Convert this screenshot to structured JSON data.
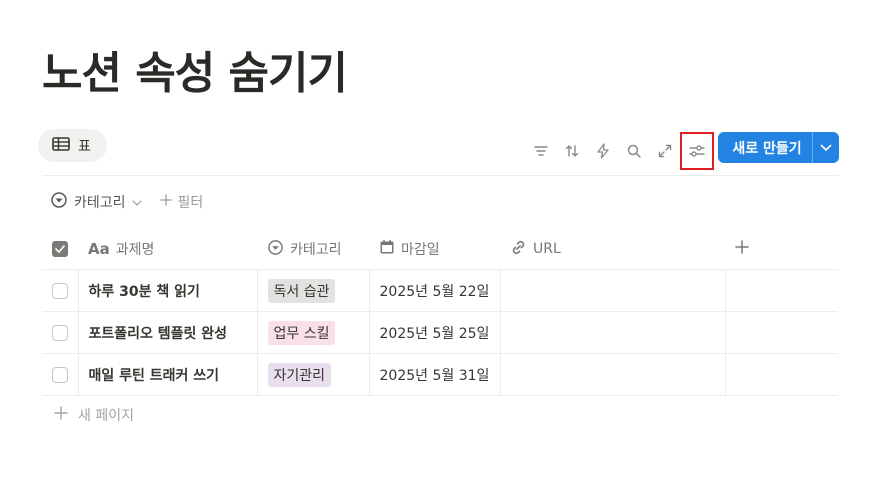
{
  "page": {
    "title": "노션 속성 숨기기"
  },
  "view_tab": {
    "label": "표",
    "icon": "table-icon"
  },
  "toolbar": {
    "icons": [
      "filter-icon",
      "sort-icon",
      "automation-icon",
      "search-icon",
      "expand-icon",
      "settings-sliders-icon"
    ],
    "new_button_label": "새로 만들기",
    "accent_color": "#2383e2",
    "highlight_color": "#e02020"
  },
  "filters": {
    "category_filter": "카테고리",
    "add_filter": "필터"
  },
  "table": {
    "headers": {
      "title": "과제명",
      "category": "카테고리",
      "deadline": "마감일",
      "url": "URL"
    },
    "rows": [
      {
        "title": "하루 30분 책 읽기",
        "category": "독서 습관",
        "category_color": "#e3e2e0",
        "deadline": "2025년 5월 22일",
        "url": ""
      },
      {
        "title": "포트폴리오 템플릿 완성",
        "category": "업무 스킬",
        "category_color": "#f9dfe9",
        "deadline": "2025년 5월 25일",
        "url": ""
      },
      {
        "title": "매일 루틴 트래커 쓰기",
        "category": "자기관리",
        "category_color": "#e8deee",
        "deadline": "2025년 5월 31일",
        "url": ""
      }
    ]
  },
  "new_page": {
    "label": "새 페이지"
  }
}
